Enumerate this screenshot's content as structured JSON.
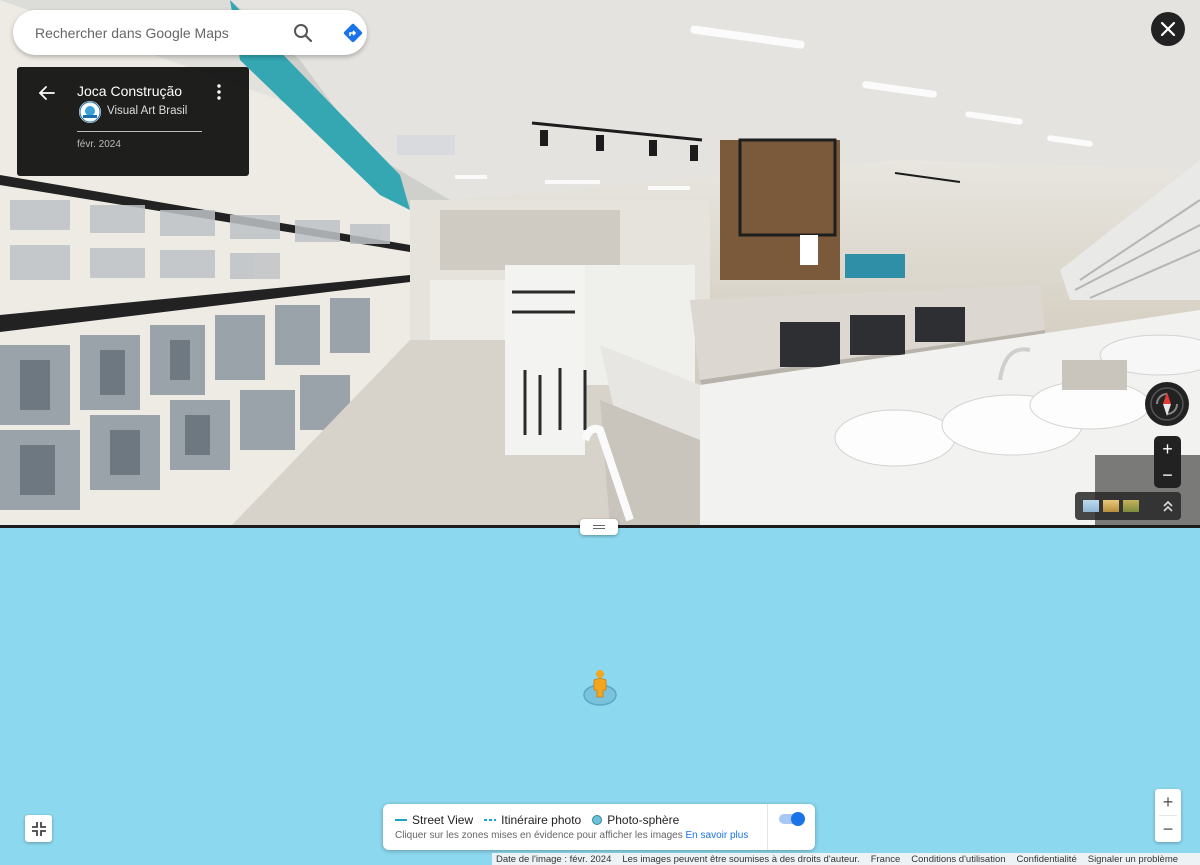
{
  "search": {
    "placeholder": "Rechercher dans Google Maps",
    "search_icon": "search-icon",
    "directions_icon": "directions-icon"
  },
  "info_card": {
    "title": "Joca Construção",
    "author": "Visual Art Brasil",
    "date": "févr. 2024"
  },
  "pano_controls": {
    "zoom_in": "+",
    "zoom_out": "−"
  },
  "legend": {
    "street_view": "Street View",
    "photo_path": "Itinéraire photo",
    "photo_sphere": "Photo-sphère",
    "hint": "Cliquer sur les zones mises en évidence pour afficher les images",
    "learn_more": "En savoir plus",
    "toggle_on": true
  },
  "map_controls": {
    "zoom_in": "+",
    "zoom_out": "−"
  },
  "footer": {
    "image_date": "Date de l'image : févr. 2024",
    "rights": "Les images peuvent être soumises à des droits d'auteur.",
    "country": "France",
    "terms": "Conditions d'utilisation",
    "privacy": "Confidentialité",
    "report": "Signaler un problème"
  },
  "colors": {
    "map_background": "#8cd8ee",
    "accent_blue": "#1a73e8",
    "coverage_cyan": "#19a3c4",
    "pegman_orange": "#f4a61e"
  }
}
